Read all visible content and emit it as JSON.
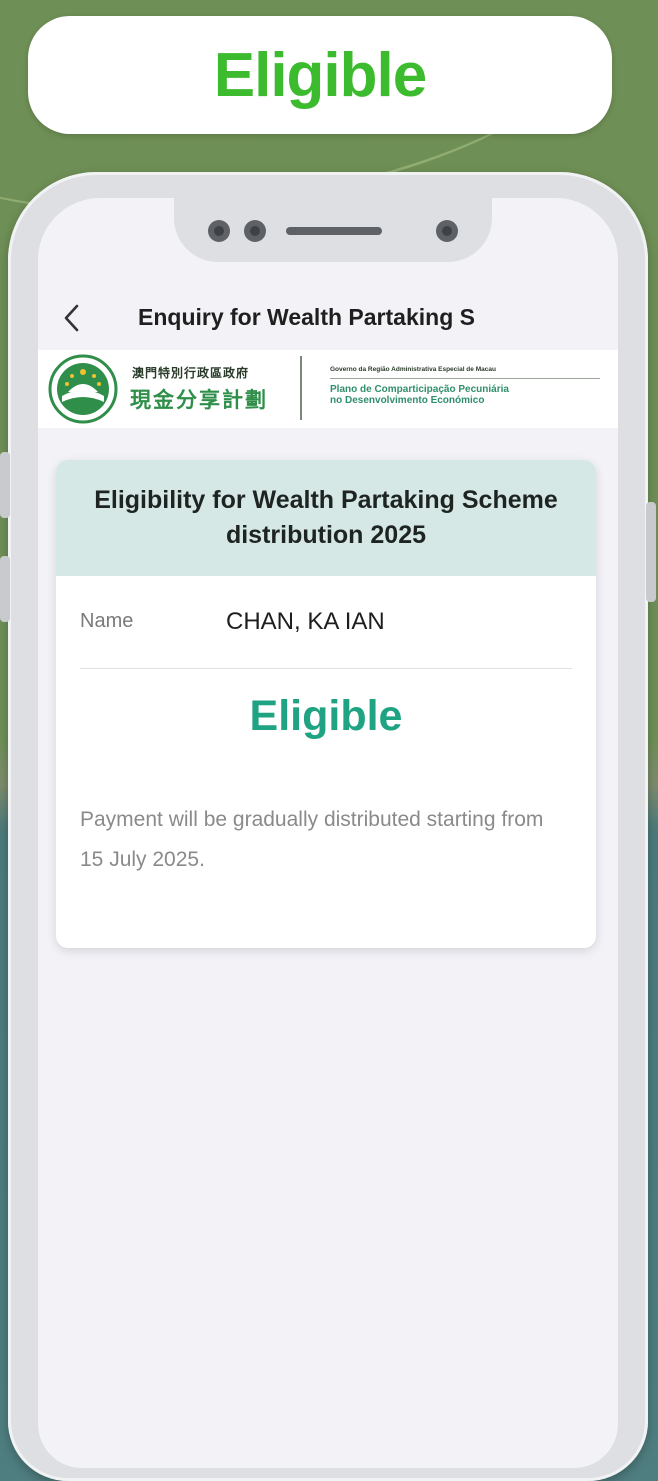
{
  "banner": {
    "text": "Eligible"
  },
  "nav": {
    "back_icon": "chevron-left-icon",
    "title": "Enquiry for Wealth Partaking S"
  },
  "logo": {
    "emblem_icon": "macao-emblem-icon",
    "cn_small": "澳門特別行政區政府",
    "cn_main": "現金分享計劃",
    "pt_small": "Governo da Região Administrativa Especial de Macau",
    "pt_main_1": "Plano de Comparticipação Pecuniária",
    "pt_main_2": "no Desenvolvimento Económico"
  },
  "card": {
    "title": "Eligibility for Wealth Partaking Scheme distribution 2025",
    "name_label": "Name",
    "name_value": "CHAN, KA IAN",
    "status": "Eligible",
    "note": "Payment will be gradually distributed starting from 15 July 2025."
  },
  "colors": {
    "banner_green": "#3dbb2e",
    "status_teal": "#1fa382",
    "card_header": "#d6e8e5"
  }
}
